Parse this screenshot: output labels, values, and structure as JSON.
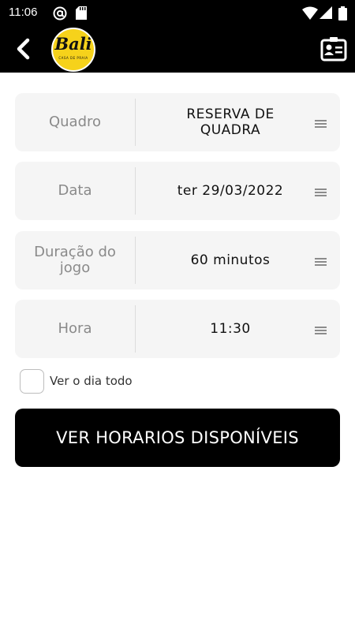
{
  "status_bar": {
    "time": "11:06",
    "icons": [
      "at-sign-icon",
      "sd-card-icon",
      "wifi-icon",
      "signal-icon",
      "battery-icon"
    ]
  },
  "app_bar": {
    "back_icon": "chevron-left-icon",
    "logo": {
      "name": "Bali",
      "tagline": "CASA DE PRAIA",
      "color": "#f6d21b"
    },
    "action_icon": "contact-card-icon"
  },
  "form": {
    "rows": [
      {
        "label": "Quadro",
        "value": "RESERVA DE QUADRA"
      },
      {
        "label": "Data",
        "value": "ter 29/03/2022"
      },
      {
        "label": "Duração do jogo",
        "value": "60 minutos"
      },
      {
        "label": "Hora",
        "value": "11:30"
      }
    ],
    "checkbox": {
      "label": "Ver o dia todo",
      "checked": false
    },
    "submit_label": "VER HORARIOS DISPONÍVEIS"
  },
  "colors": {
    "bar": "#000000",
    "row_bg": "#f5f5f5",
    "label": "#8a8a8a"
  }
}
